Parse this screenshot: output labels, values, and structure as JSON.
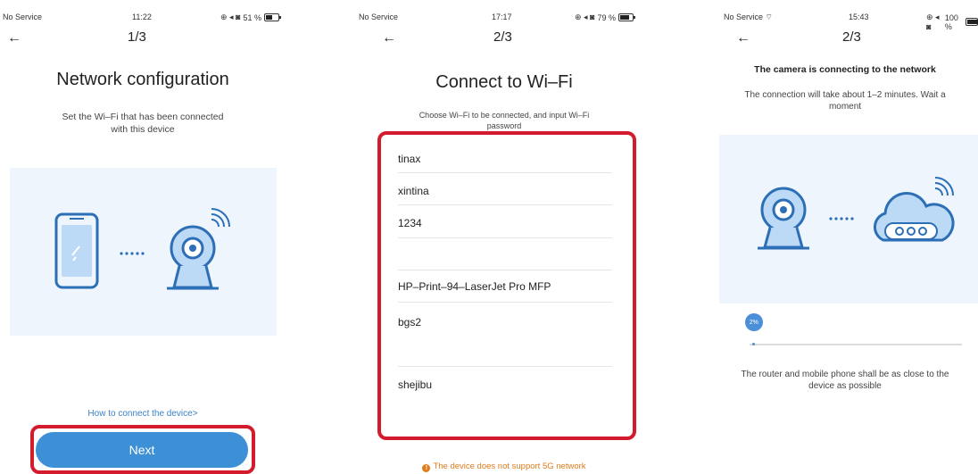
{
  "screens": [
    {
      "status": {
        "carrier": "No Service",
        "time": "11:22",
        "battery": "51 %",
        "battery_level": 0.51
      },
      "nav": {
        "back_icon": "arrow-left-icon",
        "step": "1/3"
      },
      "title": "Network configuration",
      "subtitle_lines": [
        "Set the Wi–Fi that has been connected",
        "with this device"
      ],
      "help_link": "How to connect the device>",
      "next_label": "Next"
    },
    {
      "status": {
        "carrier": "No Service",
        "time": "17:17",
        "battery": "79 %",
        "battery_level": 0.79
      },
      "nav": {
        "back_icon": "arrow-left-icon",
        "step": "2/3"
      },
      "title": "Connect to Wi–Fi",
      "subtitle_lines": [
        "Choose Wi–Fi to be connected, and input Wi–Fi",
        "password"
      ],
      "wifi_networks": [
        "tinax",
        "xintina",
        "1234",
        "HP–Print–94–LaserJet Pro MFP",
        "bgs2",
        "shejibu"
      ],
      "warning": "The device does not support 5G network"
    },
    {
      "status": {
        "carrier": "No Service",
        "time": "15:43",
        "battery": "100 %",
        "battery_level": 1.0
      },
      "nav": {
        "back_icon": "arrow-left-icon",
        "step": "2/3"
      },
      "title": "The camera is connecting to the network",
      "subtitle_lines": [
        "The connection will take about 1–2 minutes. Wait a",
        "moment"
      ],
      "progress": {
        "label": "2%",
        "value": 0.02
      },
      "tip_lines": [
        "The router and mobile phone shall be as close to the",
        "device as possible"
      ]
    }
  ],
  "colors": {
    "accent": "#3d8fd6",
    "highlight_frame": "#d41a2d",
    "warning": "#e07b1a",
    "illustration_bg": "#eef5fc"
  }
}
